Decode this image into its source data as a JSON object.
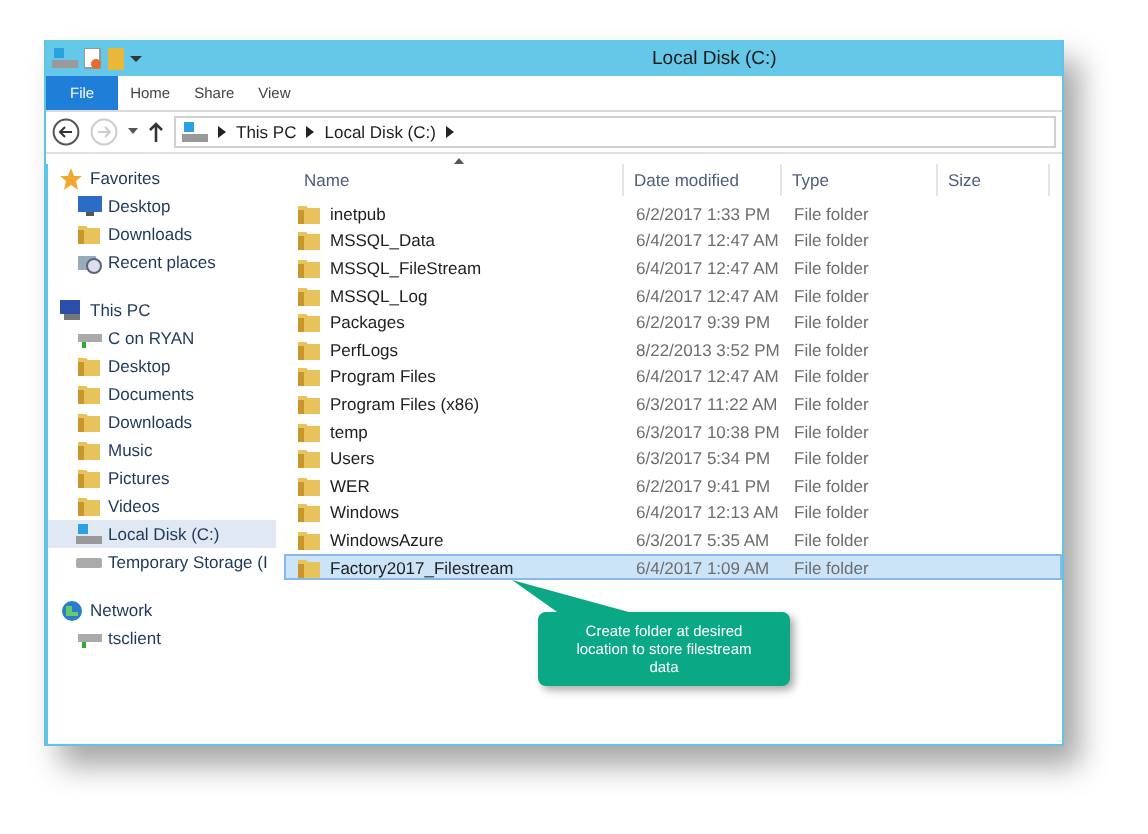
{
  "window": {
    "title": "Local Disk (C:)"
  },
  "ribbon_tabs": [
    {
      "label": "File",
      "kind": "file"
    },
    {
      "label": "Home",
      "kind": "tab"
    },
    {
      "label": "Share",
      "kind": "tab"
    },
    {
      "label": "View",
      "kind": "tab"
    }
  ],
  "address": [
    "This PC",
    "Local Disk (C:)"
  ],
  "sidebar": [
    {
      "label": "Favorites",
      "kind": "star",
      "selected": false,
      "children": [
        {
          "label": "Desktop",
          "kind": "desktop",
          "selected": false
        },
        {
          "label": "Downloads",
          "kind": "folder",
          "selected": false
        },
        {
          "label": "Recent places",
          "kind": "recent",
          "selected": false
        }
      ]
    },
    {
      "label": "This PC",
      "kind": "pc",
      "selected": false,
      "children": [
        {
          "label": "C on RYAN",
          "kind": "netdrive",
          "selected": false
        },
        {
          "label": "Desktop",
          "kind": "folder",
          "selected": false
        },
        {
          "label": "Documents",
          "kind": "folder",
          "selected": false
        },
        {
          "label": "Downloads",
          "kind": "folder",
          "selected": false
        },
        {
          "label": "Music",
          "kind": "folder",
          "selected": false
        },
        {
          "label": "Pictures",
          "kind": "folder",
          "selected": false
        },
        {
          "label": "Videos",
          "kind": "folder",
          "selected": false
        },
        {
          "label": "Local Disk (C:)",
          "kind": "windrive",
          "selected": true
        },
        {
          "label": "Temporary Storage (I",
          "kind": "drive",
          "selected": false
        }
      ]
    },
    {
      "label": "Network",
      "kind": "network",
      "selected": false,
      "children": [
        {
          "label": "tsclient",
          "kind": "netdrive",
          "selected": false
        }
      ]
    }
  ],
  "columns": [
    {
      "label": "Name",
      "sorted": true
    },
    {
      "label": "Date modified",
      "sorted": false
    },
    {
      "label": "Type",
      "sorted": false
    },
    {
      "label": "Size",
      "sorted": false
    }
  ],
  "rows": [
    {
      "name": "inetpub",
      "date": "6/2/2017 1:33 PM",
      "type": "File folder",
      "selected": false
    },
    {
      "name": "MSSQL_Data",
      "date": "6/4/2017 12:47 AM",
      "type": "File folder",
      "selected": false
    },
    {
      "name": "MSSQL_FileStream",
      "date": "6/4/2017 12:47 AM",
      "type": "File folder",
      "selected": false
    },
    {
      "name": "MSSQL_Log",
      "date": "6/4/2017 12:47 AM",
      "type": "File folder",
      "selected": false
    },
    {
      "name": "Packages",
      "date": "6/2/2017 9:39 PM",
      "type": "File folder",
      "selected": false
    },
    {
      "name": "PerfLogs",
      "date": "8/22/2013 3:52 PM",
      "type": "File folder",
      "selected": false
    },
    {
      "name": "Program Files",
      "date": "6/4/2017 12:47 AM",
      "type": "File folder",
      "selected": false
    },
    {
      "name": "Program Files (x86)",
      "date": "6/3/2017 11:22 AM",
      "type": "File folder",
      "selected": false
    },
    {
      "name": "temp",
      "date": "6/3/2017 10:38 PM",
      "type": "File folder",
      "selected": false
    },
    {
      "name": "Users",
      "date": "6/3/2017 5:34 PM",
      "type": "File folder",
      "selected": false
    },
    {
      "name": "WER",
      "date": "6/2/2017 9:41 PM",
      "type": "File folder",
      "selected": false
    },
    {
      "name": "Windows",
      "date": "6/4/2017 12:13 AM",
      "type": "File folder",
      "selected": false
    },
    {
      "name": "WindowsAzure",
      "date": "6/3/2017 5:35 AM",
      "type": "File folder",
      "selected": false
    },
    {
      "name": "Factory2017_Filestream",
      "date": "6/4/2017 1:09 AM",
      "type": "File folder",
      "selected": true
    }
  ],
  "callout": {
    "text": "Create folder at desired location to store filestream data"
  }
}
